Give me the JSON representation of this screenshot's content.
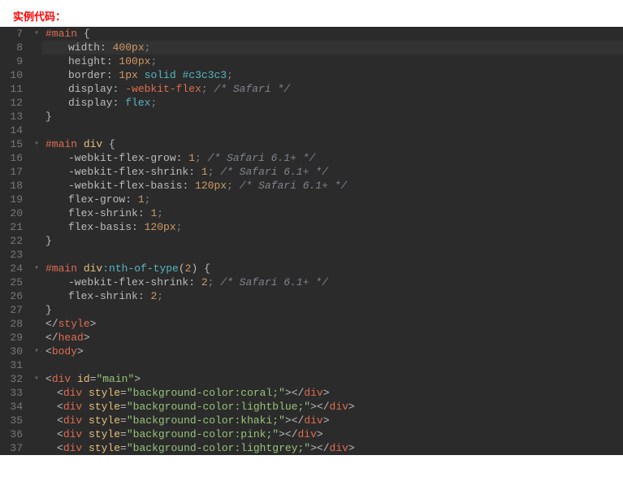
{
  "title": "实例代码：",
  "lines": [
    {
      "n": 7,
      "fold": "▾",
      "tokens": [
        [
          "sel",
          "#main"
        ],
        [
          "",
          ""
        ],
        [
          "brace",
          " {"
        ]
      ]
    },
    {
      "n": 8,
      "hl": true,
      "tokens": [
        [
          "in1",
          ""
        ],
        [
          "prop",
          "width"
        ],
        [
          "colon",
          ": "
        ],
        [
          "num",
          "400"
        ],
        [
          "unit",
          "px"
        ],
        [
          "semi",
          ";"
        ]
      ]
    },
    {
      "n": 9,
      "tokens": [
        [
          "in1",
          ""
        ],
        [
          "prop",
          "height"
        ],
        [
          "colon",
          ": "
        ],
        [
          "num",
          "100"
        ],
        [
          "unit",
          "px"
        ],
        [
          "semi",
          ";"
        ]
      ]
    },
    {
      "n": 10,
      "tokens": [
        [
          "in1",
          ""
        ],
        [
          "prop",
          "border"
        ],
        [
          "colon",
          ": "
        ],
        [
          "num",
          "1"
        ],
        [
          "unit",
          "px"
        ],
        [
          "",
          " "
        ],
        [
          "val",
          "solid"
        ],
        [
          "",
          " "
        ],
        [
          "val",
          "#c3c3c3"
        ],
        [
          "semi",
          ";"
        ]
      ]
    },
    {
      "n": 11,
      "tokens": [
        [
          "in1",
          ""
        ],
        [
          "prop",
          "display"
        ],
        [
          "colon",
          ": "
        ],
        [
          "kw",
          "-webkit-flex"
        ],
        [
          "semi",
          ";"
        ],
        [
          "",
          " "
        ],
        [
          "comment",
          "/* Safari */"
        ]
      ]
    },
    {
      "n": 12,
      "tokens": [
        [
          "in1",
          ""
        ],
        [
          "prop",
          "display"
        ],
        [
          "colon",
          ": "
        ],
        [
          "val",
          "flex"
        ],
        [
          "semi",
          ";"
        ]
      ]
    },
    {
      "n": 13,
      "tokens": [
        [
          "brace",
          "}"
        ]
      ]
    },
    {
      "n": 14,
      "tokens": [
        [
          "",
          ""
        ]
      ]
    },
    {
      "n": 15,
      "fold": "▾",
      "tokens": [
        [
          "sel",
          "#main"
        ],
        [
          "",
          " "
        ],
        [
          "tagsel",
          "div"
        ],
        [
          "",
          " "
        ],
        [
          "brace",
          "{"
        ]
      ]
    },
    {
      "n": 16,
      "tokens": [
        [
          "in1",
          ""
        ],
        [
          "prop",
          "-webkit-flex-grow"
        ],
        [
          "colon",
          ": "
        ],
        [
          "num",
          "1"
        ],
        [
          "semi",
          ";"
        ],
        [
          "",
          " "
        ],
        [
          "comment",
          "/* Safari 6.1+ */"
        ]
      ]
    },
    {
      "n": 17,
      "tokens": [
        [
          "in1",
          ""
        ],
        [
          "prop",
          "-webkit-flex-shrink"
        ],
        [
          "colon",
          ": "
        ],
        [
          "num",
          "1"
        ],
        [
          "semi",
          ";"
        ],
        [
          "",
          " "
        ],
        [
          "comment",
          "/* Safari 6.1+ */"
        ]
      ]
    },
    {
      "n": 18,
      "tokens": [
        [
          "in1",
          ""
        ],
        [
          "prop",
          "-webkit-flex-basis"
        ],
        [
          "colon",
          ": "
        ],
        [
          "num",
          "120"
        ],
        [
          "unit",
          "px"
        ],
        [
          "semi",
          ";"
        ],
        [
          "",
          " "
        ],
        [
          "comment",
          "/* Safari 6.1+ */"
        ]
      ]
    },
    {
      "n": 19,
      "tokens": [
        [
          "in1",
          ""
        ],
        [
          "prop",
          "flex-grow"
        ],
        [
          "colon",
          ": "
        ],
        [
          "num",
          "1"
        ],
        [
          "semi",
          ";"
        ]
      ]
    },
    {
      "n": 20,
      "tokens": [
        [
          "in1",
          ""
        ],
        [
          "prop",
          "flex-shrink"
        ],
        [
          "colon",
          ": "
        ],
        [
          "num",
          "1"
        ],
        [
          "semi",
          ";"
        ]
      ]
    },
    {
      "n": 21,
      "tokens": [
        [
          "in1",
          ""
        ],
        [
          "prop",
          "flex-basis"
        ],
        [
          "colon",
          ": "
        ],
        [
          "num",
          "120"
        ],
        [
          "unit",
          "px"
        ],
        [
          "semi",
          ";"
        ]
      ]
    },
    {
      "n": 22,
      "tokens": [
        [
          "brace",
          "}"
        ]
      ]
    },
    {
      "n": 23,
      "tokens": [
        [
          "",
          ""
        ]
      ]
    },
    {
      "n": 24,
      "fold": "▾",
      "tokens": [
        [
          "sel",
          "#main"
        ],
        [
          "",
          " "
        ],
        [
          "tagsel",
          "div"
        ],
        [
          "pseudo",
          ":nth-of-type"
        ],
        [
          "brace",
          "("
        ],
        [
          "num",
          "2"
        ],
        [
          "brace",
          ")"
        ],
        [
          "",
          " "
        ],
        [
          "brace",
          "{"
        ]
      ]
    },
    {
      "n": 25,
      "tokens": [
        [
          "in1",
          ""
        ],
        [
          "prop",
          "-webkit-flex-shrink"
        ],
        [
          "colon",
          ": "
        ],
        [
          "num",
          "2"
        ],
        [
          "semi",
          ";"
        ],
        [
          "",
          " "
        ],
        [
          "comment",
          "/* Safari 6.1+ */"
        ]
      ]
    },
    {
      "n": 26,
      "tokens": [
        [
          "in1",
          ""
        ],
        [
          "prop",
          "flex-shrink"
        ],
        [
          "colon",
          ": "
        ],
        [
          "num",
          "2"
        ],
        [
          "semi",
          ";"
        ]
      ]
    },
    {
      "n": 27,
      "tokens": [
        [
          "brace",
          "}"
        ]
      ]
    },
    {
      "n": 28,
      "tokens": [
        [
          "tag",
          "</"
        ],
        [
          "tagname",
          "style"
        ],
        [
          "tag",
          ">"
        ]
      ]
    },
    {
      "n": 29,
      "tokens": [
        [
          "tag",
          "</"
        ],
        [
          "tagname",
          "head"
        ],
        [
          "tag",
          ">"
        ]
      ]
    },
    {
      "n": 30,
      "fold": "▾",
      "tokens": [
        [
          "tag",
          "<"
        ],
        [
          "tagname",
          "body"
        ],
        [
          "tag",
          ">"
        ]
      ]
    },
    {
      "n": 31,
      "tokens": [
        [
          "",
          ""
        ]
      ]
    },
    {
      "n": 32,
      "fold": "▾",
      "tokens": [
        [
          "tag",
          "<"
        ],
        [
          "tagname",
          "div"
        ],
        [
          "",
          " "
        ],
        [
          "attr",
          "id"
        ],
        [
          "eq",
          "="
        ],
        [
          "str",
          "\"main\""
        ],
        [
          "tag",
          ">"
        ]
      ]
    },
    {
      "n": 33,
      "tokens": [
        [
          "in2",
          ""
        ],
        [
          "tag",
          "<"
        ],
        [
          "tagname",
          "div"
        ],
        [
          "",
          " "
        ],
        [
          "attr",
          "style"
        ],
        [
          "eq",
          "="
        ],
        [
          "str",
          "\"background-color:coral;\""
        ],
        [
          "tag",
          "></"
        ],
        [
          "tagname",
          "div"
        ],
        [
          "tag",
          ">"
        ]
      ]
    },
    {
      "n": 34,
      "tokens": [
        [
          "in2",
          ""
        ],
        [
          "tag",
          "<"
        ],
        [
          "tagname",
          "div"
        ],
        [
          "",
          " "
        ],
        [
          "attr",
          "style"
        ],
        [
          "eq",
          "="
        ],
        [
          "str",
          "\"background-color:lightblue;\""
        ],
        [
          "tag",
          "></"
        ],
        [
          "tagname",
          "div"
        ],
        [
          "tag",
          ">"
        ]
      ]
    },
    {
      "n": 35,
      "tokens": [
        [
          "in2",
          ""
        ],
        [
          "tag",
          "<"
        ],
        [
          "tagname",
          "div"
        ],
        [
          "",
          " "
        ],
        [
          "attr",
          "style"
        ],
        [
          "eq",
          "="
        ],
        [
          "str",
          "\"background-color:khaki;\""
        ],
        [
          "tag",
          "></"
        ],
        [
          "tagname",
          "div"
        ],
        [
          "tag",
          ">"
        ]
      ]
    },
    {
      "n": 36,
      "tokens": [
        [
          "in2",
          ""
        ],
        [
          "tag",
          "<"
        ],
        [
          "tagname",
          "div"
        ],
        [
          "",
          " "
        ],
        [
          "attr",
          "style"
        ],
        [
          "eq",
          "="
        ],
        [
          "str",
          "\"background-color:pink;\""
        ],
        [
          "tag",
          "></"
        ],
        [
          "tagname",
          "div"
        ],
        [
          "tag",
          ">"
        ]
      ]
    },
    {
      "n": 37,
      "tokens": [
        [
          "in2",
          ""
        ],
        [
          "tag",
          "<"
        ],
        [
          "tagname",
          "div"
        ],
        [
          "",
          " "
        ],
        [
          "attr",
          "style"
        ],
        [
          "eq",
          "="
        ],
        [
          "str",
          "\"background-color:lightgrey;\""
        ],
        [
          "tag",
          "></"
        ],
        [
          "tagname",
          "div"
        ],
        [
          "tag",
          ">"
        ]
      ]
    }
  ]
}
